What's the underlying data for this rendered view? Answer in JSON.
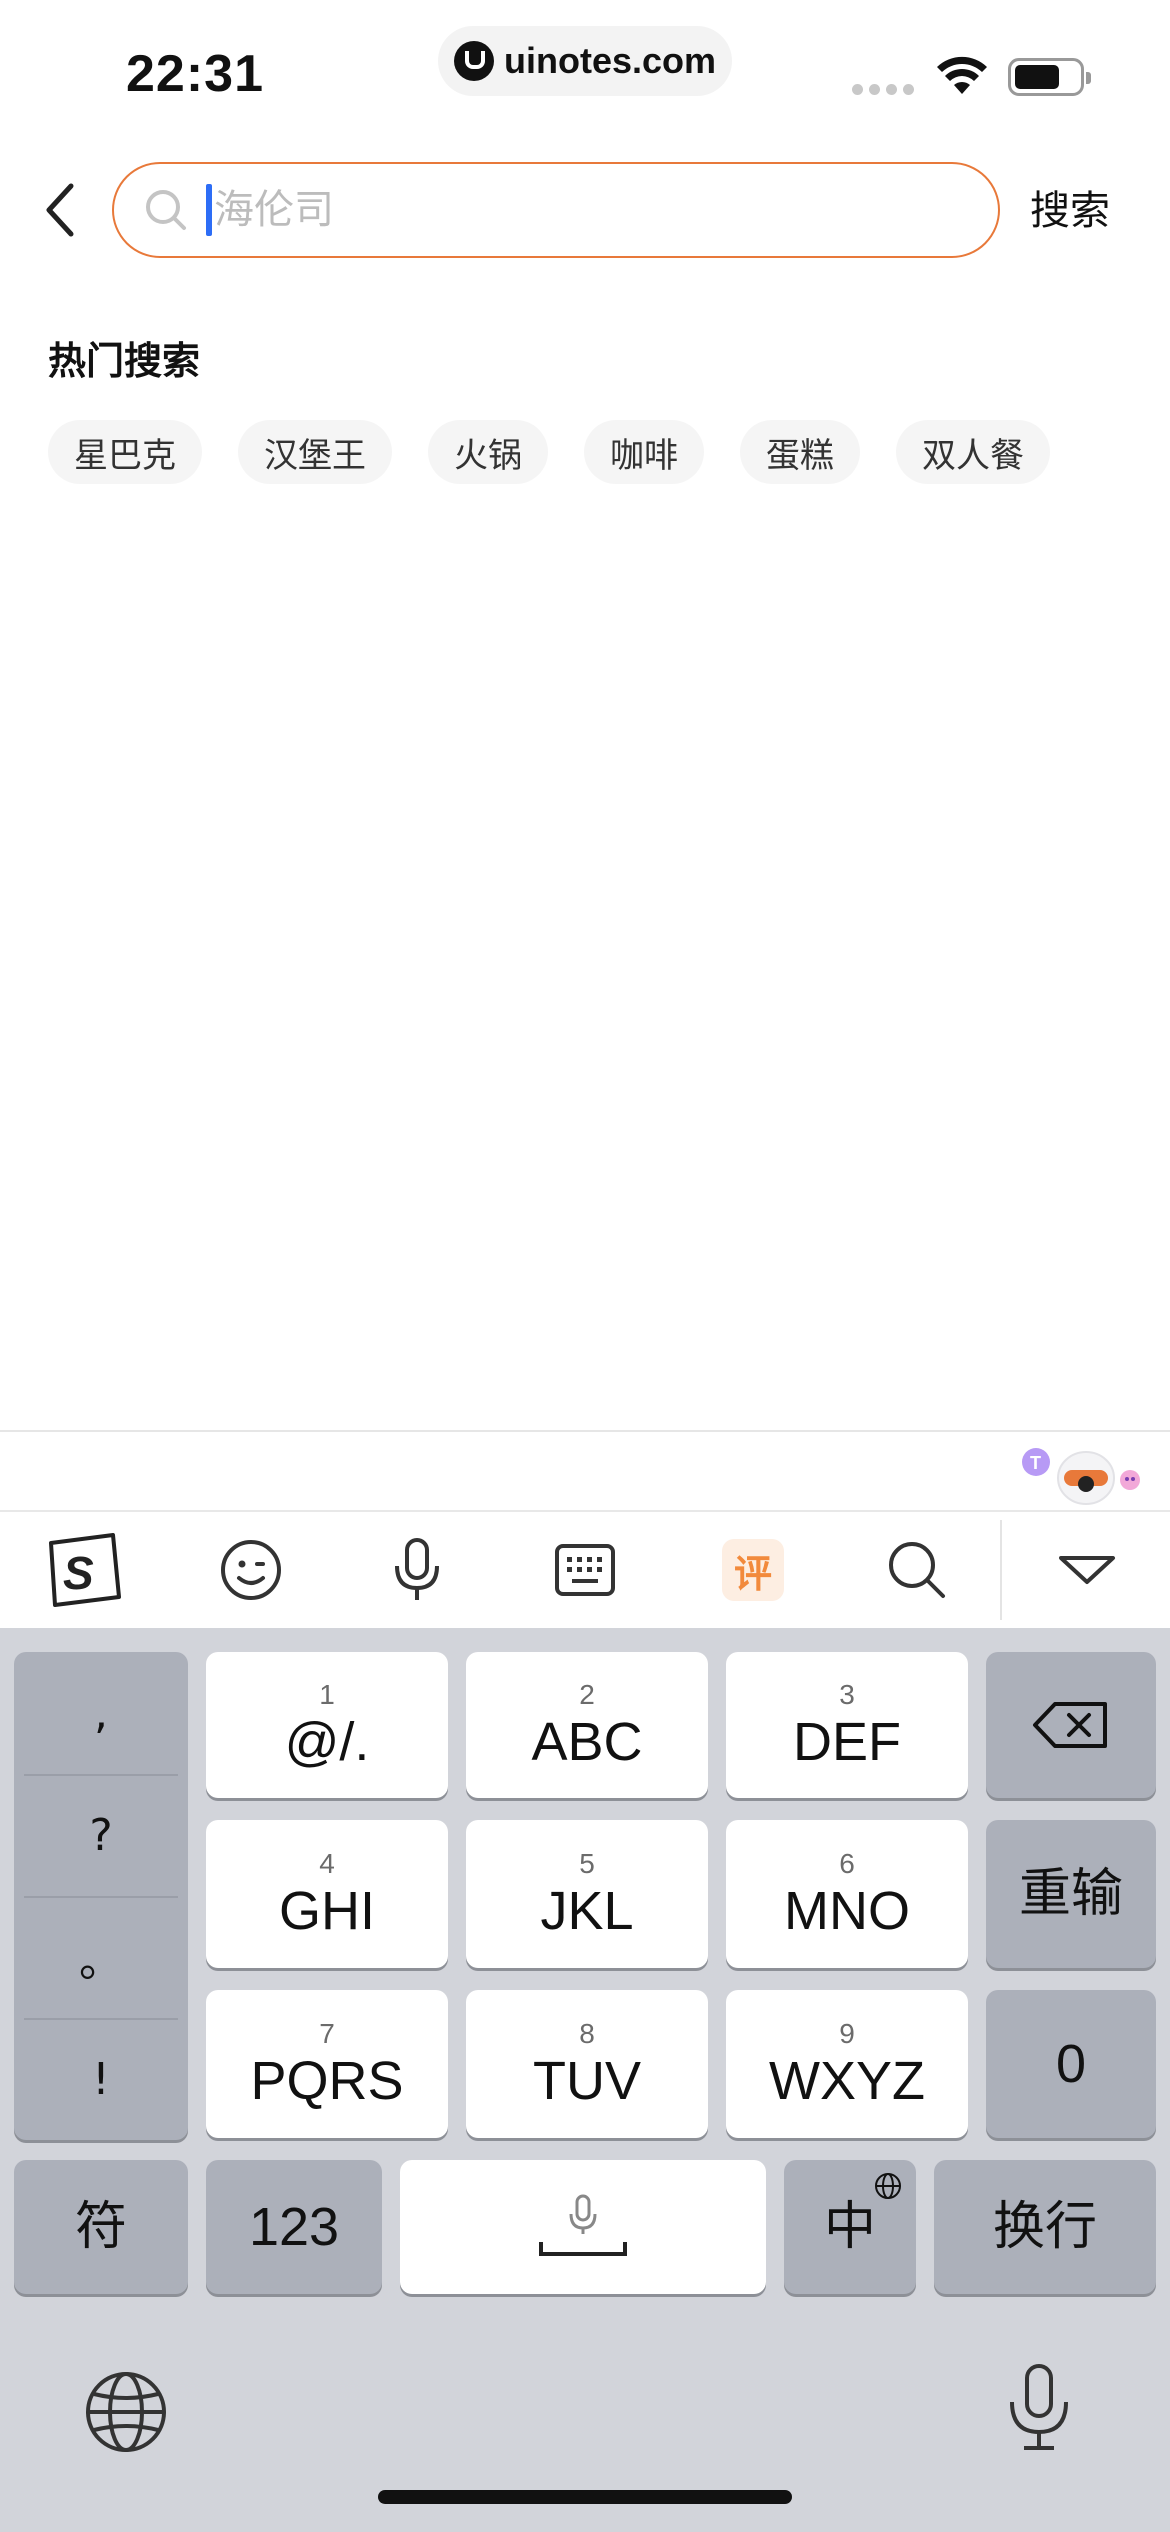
{
  "status_bar": {
    "time": "22:31",
    "url": "uinotes.com"
  },
  "search": {
    "placeholder": "海伦司",
    "value": "",
    "submit_label": "搜索"
  },
  "hot_search": {
    "title": "热门搜索",
    "tags": [
      "星巴克",
      "汉堡王",
      "火锅",
      "咖啡",
      "蛋糕",
      "双人餐"
    ]
  },
  "keyboard_toolbar": {
    "items": [
      "sogou-logo-icon",
      "emoji-icon",
      "voice-icon",
      "keyboard-icon",
      "review-icon",
      "search-icon",
      "collapse-icon"
    ],
    "review_label": "评"
  },
  "keyboard": {
    "punctuation": [
      ",",
      "?",
      "。",
      "!"
    ],
    "keys": [
      {
        "num": "1",
        "label": "@/."
      },
      {
        "num": "2",
        "label": "ABC"
      },
      {
        "num": "3",
        "label": "DEF"
      },
      {
        "num": "4",
        "label": "GHI"
      },
      {
        "num": "5",
        "label": "JKL"
      },
      {
        "num": "6",
        "label": "MNO"
      },
      {
        "num": "7",
        "label": "PQRS"
      },
      {
        "num": "8",
        "label": "TUV"
      },
      {
        "num": "9",
        "label": "WXYZ"
      }
    ],
    "reset_label": "重输",
    "zero_label": "0",
    "symbol_label": "符",
    "numeric_label": "123",
    "lang_label": "中",
    "return_label": "换行"
  }
}
